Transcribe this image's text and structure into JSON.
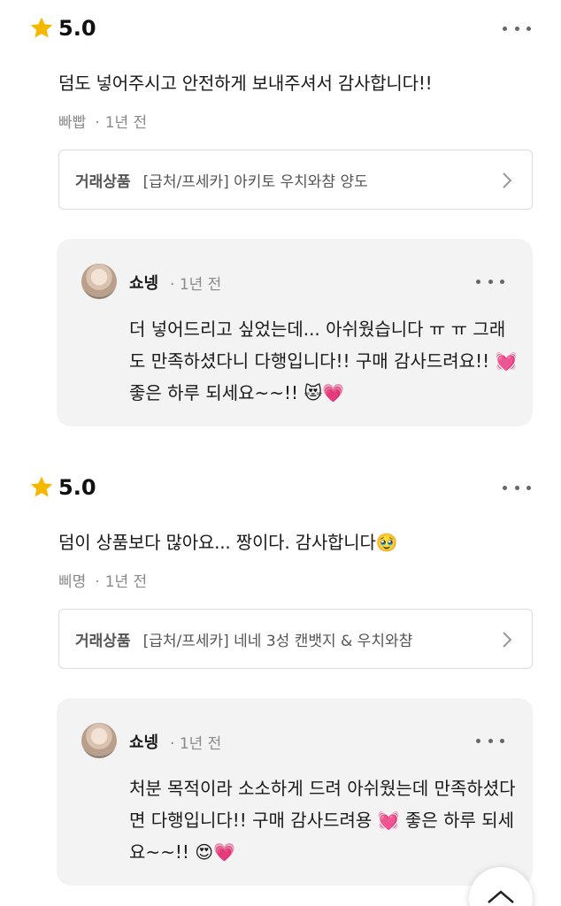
{
  "reviews": [
    {
      "rating": "5.0",
      "text": "덤도 넣어주시고 안전하게 보내주셔서 감사합니다!!",
      "author": "빠빱",
      "time": "1년 전",
      "product_label": "거래상품",
      "product_name": "[급처/프세카] 아키토 우치와챰 양도",
      "reply": {
        "name": "쇼넹",
        "time": "1년 전",
        "text": "더 넣어드리고 싶었는데... 아쉬웠습니다 ㅠ ㅠ 그래도 만족하셨다니 다행입니다!! 구매 감사드려요!! 💓 좋은 하루 되세요~~!! 😻💗"
      }
    },
    {
      "rating": "5.0",
      "text": "덤이 상품보다 많아요... 짱이다. 감사합니다🥹",
      "author": "삐명",
      "time": "1년 전",
      "product_label": "거래상품",
      "product_name": "[급처/프세카] 네네 3성 캔뱃지 & 우치와챰",
      "reply": {
        "name": "쇼넹",
        "time": "1년 전",
        "text": "처분 목적이라 소소하게 드려 아쉬웠는데 만족하셨다면 다행입니다!! 구매 감사드려용 💓 좋은 하루 되세요~~!! 😍💗"
      }
    }
  ],
  "icons": {
    "star": "star-icon",
    "more": "more-icon",
    "chevron": "chevron-right-icon",
    "scroll_top": "chevron-up-icon"
  },
  "colors": {
    "star": "#f5b800",
    "reply_bg": "#f3f3f3",
    "meta": "#8a8a8a"
  }
}
